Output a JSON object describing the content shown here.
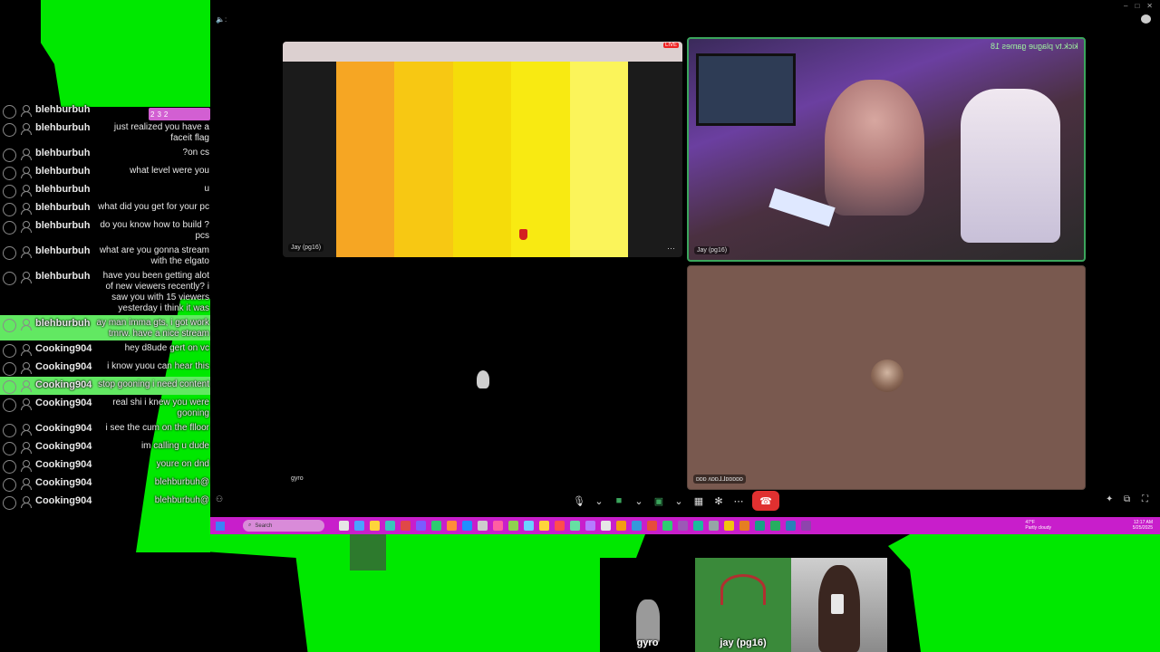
{
  "chat": {
    "messages": [
      {
        "user": "blehburbuh",
        "text": "",
        "highlight": false
      },
      {
        "user": "blehburbuh",
        "text": "just realized you have a faceit flag",
        "highlight": false
      },
      {
        "user": "blehburbuh",
        "text": "?on cs",
        "highlight": false
      },
      {
        "user": "blehburbuh",
        "text": "what level were you",
        "highlight": false
      },
      {
        "user": "blehburbuh",
        "text": "u",
        "highlight": false
      },
      {
        "user": "blehburbuh",
        "text": "what did you get for your pc",
        "highlight": false
      },
      {
        "user": "blehburbuh",
        "text": "do you know how to build ?pcs",
        "highlight": false
      },
      {
        "user": "blehburbuh",
        "text": "what are you gonna stream with the elgato",
        "highlight": false
      },
      {
        "user": "blehburbuh",
        "text": "have you been getting alot of new viewers recently? i saw you with 15 viewers yesterday i think it was",
        "highlight": false
      },
      {
        "user": "blehburbuh",
        "text": "ay man imma gts, i got work tmrw. have a nice stream",
        "highlight": true
      },
      {
        "user": "Cooking904",
        "text": "hey d8ude gert on vc",
        "highlight": false
      },
      {
        "user": "Cooking904",
        "text": "i know yuou can hear this",
        "highlight": false
      },
      {
        "user": "Cooking904",
        "text": "stop gooning i need content",
        "highlight": true
      },
      {
        "user": "Cooking904",
        "text": "real shi i knew you were gooning",
        "highlight": false
      },
      {
        "user": "Cooking904",
        "text": "i see the cum on the flloor",
        "highlight": false
      },
      {
        "user": "Cooking904",
        "text": "im calling u dude",
        "highlight": false
      },
      {
        "user": "Cooking904",
        "text": "youre on dnd",
        "highlight": false
      },
      {
        "user": "Cooking904",
        "text": "blehburbuh@",
        "highlight": false
      },
      {
        "user": "Cooking904",
        "text": "blehburbuh@",
        "highlight": false
      }
    ],
    "badges": [
      "2",
      "3",
      "2"
    ]
  },
  "call": {
    "tiles": [
      {
        "label": "Jay (pg16)"
      },
      {
        "label": "Jay (pg16)",
        "overlay_text": "kick.tv plague games 18"
      },
      {
        "label": "gyro"
      },
      {
        "label": "ᴅᴅᴅ ᴧᴅᴅ⅃⅃ᴅᴅᴅᴅᴅ"
      }
    ],
    "stripe_colors": [
      "#f6a623",
      "#f7c813",
      "#f5dc0a",
      "#f8ea12",
      "#fbf45a"
    ],
    "live_badge": "LIVE"
  },
  "taskbar": {
    "search_placeholder": "Search",
    "weather_line1": "47°F",
    "weather_line2": "Partly cloudy",
    "time": "12:17 AM",
    "date": "5/25/2025"
  },
  "cams": [
    {
      "name": "gyro"
    },
    {
      "name": "jay (pg16)"
    }
  ]
}
